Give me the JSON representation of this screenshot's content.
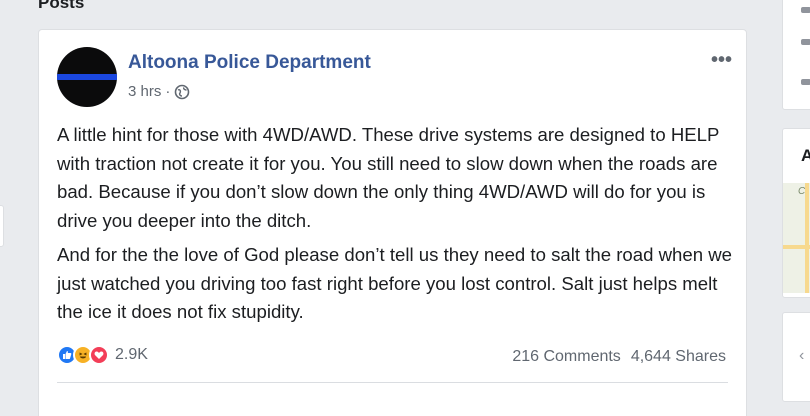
{
  "section": {
    "title": "Posts"
  },
  "post": {
    "author": "Altoona Police Department",
    "time": "3 hrs",
    "separator": "·",
    "privacy_icon": "globe-icon",
    "more_label": "•••",
    "paragraphs": [
      "A little hint for those with 4WD/AWD. These drive systems are designed to HELP with traction not create it for you. You still need to slow down when the roads are bad. Because if you don’t slow down the only thing 4WD/AWD will do for you is drive you deeper into the ditch.",
      "And for the the love of God please don’t tell us they need to salt the road when we just watched you driving too fast right before you lost control. Salt just helps melt the ice it does not fix stupidity."
    ],
    "reactions": {
      "icons": [
        "like-reaction-icon",
        "haha-reaction-icon",
        "love-reaction-icon"
      ],
      "count": "2.9K"
    },
    "comments": "216 Comments",
    "shares": "4,644 Shares"
  },
  "right_column": {
    "card_letter": "A",
    "map_label": "Ci"
  },
  "colors": {
    "link_blue": "#385898",
    "avatar_stripe": "#1a47e0",
    "like": "#2078f4",
    "haha": "#f7b125",
    "love": "#f33e58",
    "page_bg": "#e9ebee"
  }
}
